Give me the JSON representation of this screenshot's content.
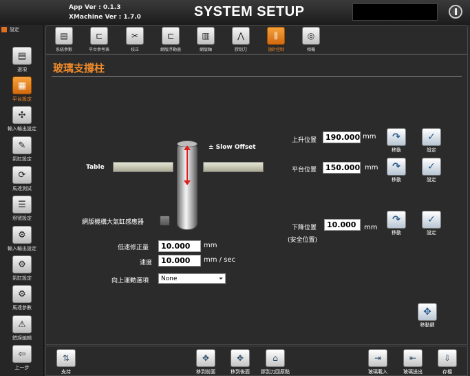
{
  "header": {
    "app_ver": "App Ver : 0.1.3",
    "xmachine_ver": "XMachine Ver : 1.7.0",
    "title": "SYSTEM SETUP"
  },
  "sidebar": {
    "top_label": "設定",
    "items": [
      {
        "label": "選項",
        "icon": "list-icon",
        "glyph": "▤",
        "active": false
      },
      {
        "label": "平台設定",
        "icon": "platform-grid-icon",
        "glyph": "▦",
        "active": true
      },
      {
        "label": "輸入輸出設定",
        "icon": "io-nodes-icon",
        "glyph": "✣",
        "active": false
      },
      {
        "label": "氣缸設定",
        "icon": "cylinder-wrench-icon",
        "glyph": "✎",
        "active": false
      },
      {
        "label": "馬達測試",
        "icon": "motor-test-icon",
        "glyph": "⟳",
        "active": false
      },
      {
        "label": "燈號設定",
        "icon": "light-signal-icon",
        "glyph": "☰",
        "active": false
      },
      {
        "label": "輸入輸出設定",
        "icon": "io-gear-icon",
        "glyph": "⚙",
        "active": false
      },
      {
        "label": "氣缸設定",
        "icon": "cylinder-gear-icon",
        "glyph": "⚙",
        "active": false
      },
      {
        "label": "馬達參數",
        "icon": "motor-params-icon",
        "glyph": "⚙",
        "active": false
      },
      {
        "label": "錯誤編輯",
        "icon": "warning-icon",
        "glyph": "⚠",
        "active": false
      },
      {
        "label": "上一步",
        "icon": "back-icon",
        "glyph": "⇦",
        "active": false
      }
    ]
  },
  "tabs": [
    {
      "label": "系統參數",
      "icon": "system-params-icon",
      "glyph": "▤",
      "active": false
    },
    {
      "label": "平台參考表",
      "icon": "platform-table-icon",
      "glyph": "⊏",
      "active": false
    },
    {
      "label": "校正",
      "icon": "calibrate-icon",
      "glyph": "✂",
      "active": false
    },
    {
      "label": "網版浮動器",
      "icon": "screen-float-icon",
      "glyph": "⊏",
      "active": false
    },
    {
      "label": "網版軸",
      "icon": "screen-axis-icon",
      "glyph": "▥",
      "active": false
    },
    {
      "label": "膠刮刀",
      "icon": "squeegee-icon",
      "glyph": "⋀",
      "active": false
    },
    {
      "label": "頂針控制",
      "icon": "ejector-pin-icon",
      "glyph": "⫼",
      "active": true
    },
    {
      "label": "相機",
      "icon": "camera-icon",
      "glyph": "◎",
      "active": false
    }
  ],
  "main": {
    "title": "玻璃支撐柱",
    "diagram": {
      "table_label": "Table",
      "slow_offset_label": "± Slow Offset",
      "sensor_label": "網版機構大氣缸感應器"
    },
    "positions": {
      "up_label": "上升位置",
      "up_value": "190.000",
      "platform_label": "平台位置",
      "platform_value": "150.000",
      "down_label": "下降位置",
      "down_sub_label": "(安全位置)",
      "down_value": "10.000",
      "unit": "mm",
      "move_label": "移動",
      "set_label": "設定"
    },
    "low_speed": {
      "label": "低速修正量",
      "value": "10.000",
      "unit": "mm"
    },
    "speed": {
      "label": "速度",
      "value": "10.000",
      "unit": "mm / sec"
    },
    "upward_option": {
      "label": "向上運動選項",
      "selected": "None"
    },
    "move_key_label": "移動鍵"
  },
  "bottom": {
    "buttons": [
      {
        "label": "支持",
        "icon": "support-icon",
        "glyph": "⇅"
      },
      {
        "label": "移到前面",
        "icon": "move-front-icon",
        "glyph": "✥"
      },
      {
        "label": "移到後面",
        "icon": "move-back-icon",
        "glyph": "✥"
      },
      {
        "label": "膠刮刀回原點",
        "icon": "squeegee-home-icon",
        "glyph": "⌂"
      },
      {
        "label": "玻璃載入",
        "icon": "glass-load-icon",
        "glyph": "⇥"
      },
      {
        "label": "玻璃送出",
        "icon": "glass-out-icon",
        "glyph": "⇤"
      },
      {
        "label": "存檔",
        "icon": "save-icon",
        "glyph": "⇩"
      }
    ]
  },
  "colors": {
    "accent": "#f08a2a",
    "background": "#2b2b2b",
    "arrow": "#e02020"
  }
}
